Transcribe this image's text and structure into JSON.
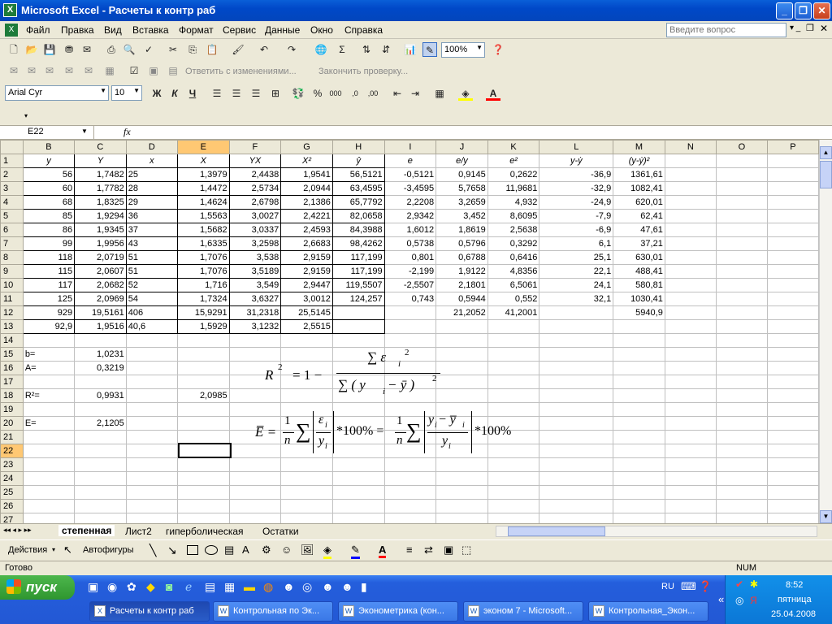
{
  "window": {
    "title": "Microsoft Excel - Расчеты к контр раб"
  },
  "menu": [
    "Файл",
    "Правка",
    "Вид",
    "Вставка",
    "Формат",
    "Сервис",
    "Данные",
    "Окно",
    "Справка"
  ],
  "help_box": {
    "placeholder": "Введите вопрос"
  },
  "toolbar": {
    "zoom": "100%",
    "font": "Arial Cyr",
    "size": "10",
    "reply_text": "Ответить с изменениями...",
    "end_review": "Закончить проверку..."
  },
  "formula_bar": {
    "cell_ref": "E22",
    "fx": "fx",
    "value": ""
  },
  "columns": [
    "B",
    "C",
    "D",
    "E",
    "F",
    "G",
    "H",
    "I",
    "J",
    "K",
    "L",
    "M",
    "N",
    "O",
    "P"
  ],
  "rows": [
    {
      "n": "1",
      "cells": [
        "y",
        "Y",
        "x",
        "X",
        "YX",
        "X²",
        "ŷ",
        "e",
        "e/y",
        "e²",
        "y-ẏ",
        "(y-ẏ)²",
        "",
        "",
        ""
      ]
    },
    {
      "n": "2",
      "cells": [
        "56",
        "1,7482",
        "25",
        "1,3979",
        "2,4438",
        "1,9541",
        "56,5121",
        "-0,5121",
        "0,9145",
        "0,2622",
        "-36,9",
        "1361,61",
        "",
        "",
        ""
      ]
    },
    {
      "n": "3",
      "cells": [
        "60",
        "1,7782",
        "28",
        "1,4472",
        "2,5734",
        "2,0944",
        "63,4595",
        "-3,4595",
        "5,7658",
        "11,9681",
        "-32,9",
        "1082,41",
        "",
        "",
        ""
      ]
    },
    {
      "n": "4",
      "cells": [
        "68",
        "1,8325",
        "29",
        "1,4624",
        "2,6798",
        "2,1386",
        "65,7792",
        "2,2208",
        "3,2659",
        "4,932",
        "-24,9",
        "620,01",
        "",
        "",
        ""
      ]
    },
    {
      "n": "5",
      "cells": [
        "85",
        "1,9294",
        "36",
        "1,5563",
        "3,0027",
        "2,4221",
        "82,0658",
        "2,9342",
        "3,452",
        "8,6095",
        "-7,9",
        "62,41",
        "",
        "",
        ""
      ]
    },
    {
      "n": "6",
      "cells": [
        "86",
        "1,9345",
        "37",
        "1,5682",
        "3,0337",
        "2,4593",
        "84,3988",
        "1,6012",
        "1,8619",
        "2,5638",
        "-6,9",
        "47,61",
        "",
        "",
        ""
      ]
    },
    {
      "n": "7",
      "cells": [
        "99",
        "1,9956",
        "43",
        "1,6335",
        "3,2598",
        "2,6683",
        "98,4262",
        "0,5738",
        "0,5796",
        "0,3292",
        "6,1",
        "37,21",
        "",
        "",
        ""
      ]
    },
    {
      "n": "8",
      "cells": [
        "118",
        "2,0719",
        "51",
        "1,7076",
        "3,538",
        "2,9159",
        "117,199",
        "0,801",
        "0,6788",
        "0,6416",
        "25,1",
        "630,01",
        "",
        "",
        ""
      ]
    },
    {
      "n": "9",
      "cells": [
        "115",
        "2,0607",
        "51",
        "1,7076",
        "3,5189",
        "2,9159",
        "117,199",
        "-2,199",
        "1,9122",
        "4,8356",
        "22,1",
        "488,41",
        "",
        "",
        ""
      ]
    },
    {
      "n": "10",
      "cells": [
        "117",
        "2,0682",
        "52",
        "1,716",
        "3,549",
        "2,9447",
        "119,5507",
        "-2,5507",
        "2,1801",
        "6,5061",
        "24,1",
        "580,81",
        "",
        "",
        ""
      ]
    },
    {
      "n": "11",
      "cells": [
        "125",
        "2,0969",
        "54",
        "1,7324",
        "3,6327",
        "3,0012",
        "124,257",
        "0,743",
        "0,5944",
        "0,552",
        "32,1",
        "1030,41",
        "",
        "",
        ""
      ]
    },
    {
      "n": "12",
      "cells": [
        "929",
        "19,5161",
        "406",
        "15,9291",
        "31,2318",
        "25,5145",
        "",
        "",
        "21,2052",
        "41,2001",
        "",
        "5940,9",
        "",
        "",
        ""
      ]
    },
    {
      "n": "13",
      "cells": [
        "92,9",
        "1,9516",
        "40,6",
        "1,5929",
        "3,1232",
        "2,5515",
        "",
        "",
        "",
        "",
        "",
        "",
        "",
        "",
        ""
      ]
    },
    {
      "n": "14",
      "cells": [
        "",
        "",
        "",
        "",
        "",
        "",
        "",
        "",
        "",
        "",
        "",
        "",
        "",
        "",
        ""
      ]
    },
    {
      "n": "15",
      "cells": [
        "b=",
        "1,0231",
        "",
        "",
        "",
        "",
        "",
        "",
        "",
        "",
        "",
        "",
        "",
        "",
        ""
      ]
    },
    {
      "n": "16",
      "cells": [
        "A=",
        "0,3219",
        "",
        "",
        "",
        "",
        "",
        "",
        "",
        "",
        "",
        "",
        "",
        "",
        ""
      ]
    },
    {
      "n": "17",
      "cells": [
        "",
        "",
        "",
        "",
        "",
        "",
        "",
        "",
        "",
        "",
        "",
        "",
        "",
        "",
        ""
      ]
    },
    {
      "n": "18",
      "cells": [
        "R²=",
        "0,9931",
        "",
        "2,0985",
        "",
        "",
        "",
        "",
        "",
        "",
        "",
        "",
        "",
        "",
        ""
      ]
    },
    {
      "n": "19",
      "cells": [
        "",
        "",
        "",
        "",
        "",
        "",
        "",
        "",
        "",
        "",
        "",
        "",
        "",
        "",
        ""
      ]
    },
    {
      "n": "20",
      "cells": [
        "E=",
        "2,1205",
        "",
        "",
        "",
        "",
        "",
        "",
        "",
        "",
        "",
        "",
        "",
        "",
        ""
      ]
    },
    {
      "n": "21",
      "cells": [
        "",
        "",
        "",
        "",
        "",
        "",
        "",
        "",
        "",
        "",
        "",
        "",
        "",
        "",
        ""
      ]
    },
    {
      "n": "22",
      "cells": [
        "",
        "",
        "",
        "",
        "",
        "",
        "",
        "",
        "",
        "",
        "",
        "",
        "",
        "",
        ""
      ]
    },
    {
      "n": "23",
      "cells": [
        "",
        "",
        "",
        "",
        "",
        "",
        "",
        "",
        "",
        "",
        "",
        "",
        "",
        "",
        ""
      ]
    },
    {
      "n": "24",
      "cells": [
        "",
        "",
        "",
        "",
        "",
        "",
        "",
        "",
        "",
        "",
        "",
        "",
        "",
        "",
        ""
      ]
    },
    {
      "n": "25",
      "cells": [
        "",
        "",
        "",
        "",
        "",
        "",
        "",
        "",
        "",
        "",
        "",
        "",
        "",
        "",
        ""
      ]
    },
    {
      "n": "26",
      "cells": [
        "",
        "",
        "",
        "",
        "",
        "",
        "",
        "",
        "",
        "",
        "",
        "",
        "",
        "",
        ""
      ]
    },
    {
      "n": "27",
      "cells": [
        "",
        "",
        "",
        "",
        "",
        "",
        "",
        "",
        "",
        "",
        "",
        "",
        "",
        "",
        ""
      ]
    }
  ],
  "sheet_tabs": [
    "степенная",
    "Лист2",
    "гиперболическая",
    "Остатки"
  ],
  "draw_toolbar": {
    "actions": "Действия",
    "autoshapes": "Автофигуры"
  },
  "status": {
    "ready": "Готово",
    "num": "NUM"
  },
  "taskbar": {
    "start": "пуск",
    "tasks": [
      "Расчеты к контр раб",
      "Контрольная по Эк...",
      "Эконометрика (кон...",
      "эконом 7 - Microsoft...",
      "Контрольная_Экон..."
    ],
    "lang": "RU",
    "time": "8:52",
    "day": "пятница",
    "date": "25.04.2008"
  },
  "formulas": {
    "r2_lhs": "R",
    "r2_sup": "2",
    "r2_eq": "= 1 −",
    "r2_num": "∑ ε",
    "r2_num_sub": "i",
    "r2_num_sup": "2",
    "r2_den": "∑ ( y",
    "r2_den_sub": "i",
    "r2_den_mid": " − ȳ )",
    "r2_den_sup": "2",
    "e_lhs": "E̅ =",
    "e_frac_n1": "1",
    "e_frac_d1": "n",
    "e_sum": "∑",
    "e_num1": "ε",
    "e_num1_sub": "i",
    "e_den1": "y",
    "e_den1_sub": "i",
    "e_pct1": "*100% =",
    "e_frac_n2": "1",
    "e_frac_d2": "n",
    "e_num2": "y",
    "e_num2_sub": "i",
    "e_num2_mid": " − y̅",
    "e_num2_sub2": "i",
    "e_den2": "y",
    "e_den2_sub": "i",
    "e_pct2": "*100%"
  }
}
